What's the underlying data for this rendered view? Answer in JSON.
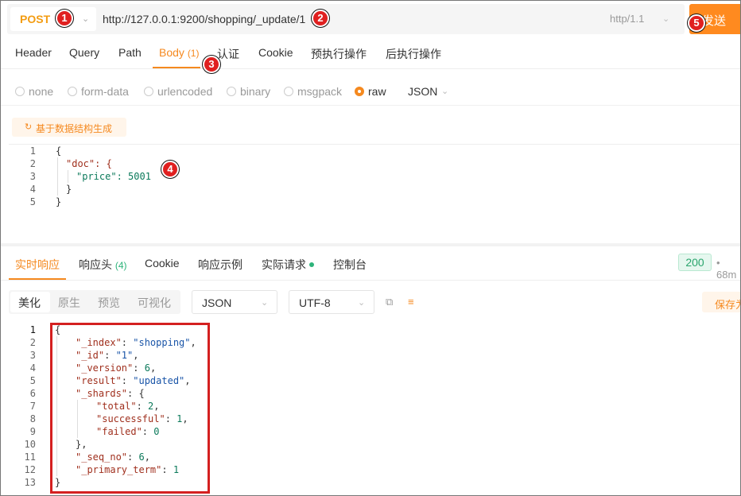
{
  "request": {
    "method": "POST",
    "url": "http://127.0.0.1:9200/shopping/_update/1",
    "http_version": "http/1.1",
    "send_label": "发送"
  },
  "badges": [
    "1",
    "2",
    "3",
    "4",
    "5"
  ],
  "request_tabs": [
    {
      "label": "Header"
    },
    {
      "label": "Query"
    },
    {
      "label": "Path"
    },
    {
      "label": "Body",
      "count": "(1)"
    },
    {
      "label": "认证"
    },
    {
      "label": "Cookie"
    },
    {
      "label": "预执行操作"
    },
    {
      "label": "后执行操作"
    }
  ],
  "body_types": [
    "none",
    "form-data",
    "urlencoded",
    "binary",
    "msgpack",
    "raw"
  ],
  "body_type_selected": "raw",
  "body_format": "JSON",
  "generate_label": "基于数据结构生成",
  "request_body": [
    "{",
    "\"doc\": {",
    "\"price\": 5001",
    "}",
    "}"
  ],
  "response_tabs": [
    {
      "label": "实时响应"
    },
    {
      "label": "响应头",
      "count": "(4)"
    },
    {
      "label": "Cookie"
    },
    {
      "label": "响应示例"
    },
    {
      "label": "实际请求"
    },
    {
      "label": "控制台"
    }
  ],
  "status_code": "200",
  "response_time": "68m",
  "view_modes": [
    "美化",
    "原生",
    "预览",
    "可视化"
  ],
  "response_format": "JSON",
  "response_encoding": "UTF-8",
  "save_label": "保存为",
  "response_body": {
    "_index": "shopping",
    "_id": "1",
    "_version": 6,
    "result": "updated",
    "_shards": {
      "total": 2,
      "successful": 1,
      "failed": 0
    },
    "_seq_no": 6,
    "_primary_term": 1
  },
  "colors": {
    "accent": "#f5891f",
    "badge": "#e02020",
    "status": "#2aa56d",
    "highlight_box": "#d42020"
  },
  "icons": [
    "chevron-down-icon",
    "refresh-icon",
    "copy-icon",
    "format-icon"
  ]
}
